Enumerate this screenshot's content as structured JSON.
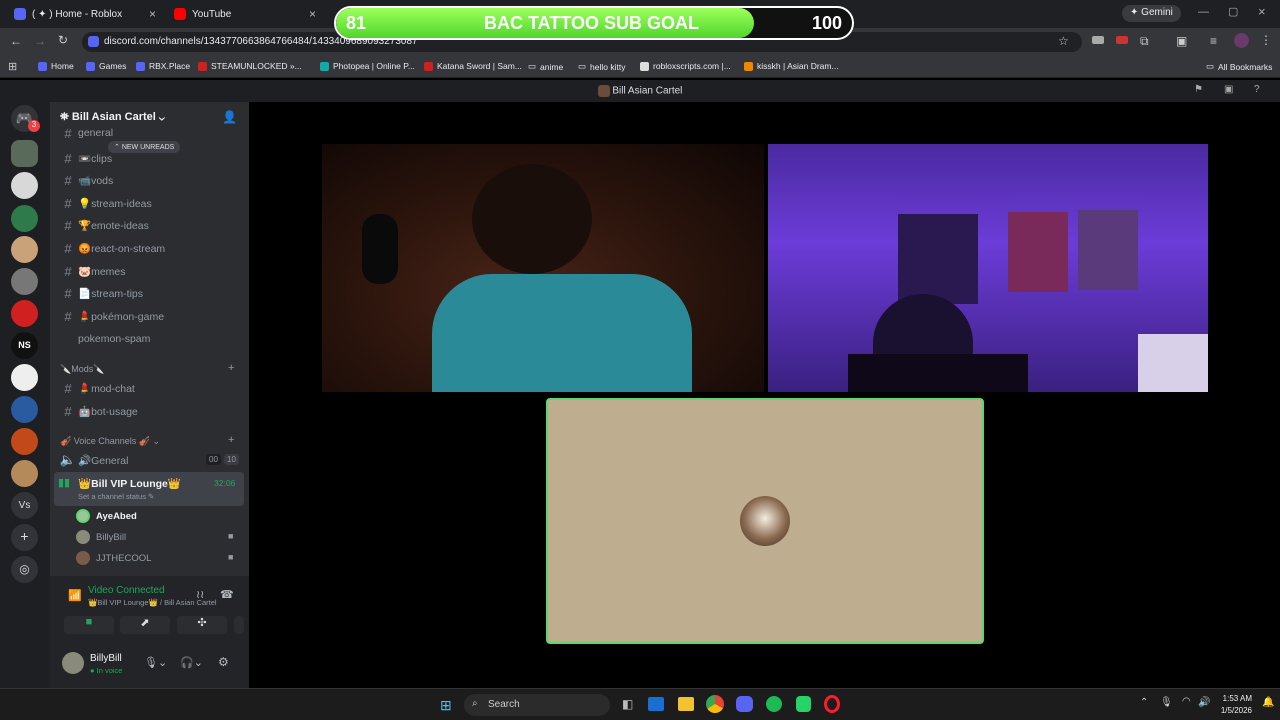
{
  "tabs": [
    {
      "label": "( ✦ ) Home - Roblox"
    },
    {
      "label": "YouTube"
    }
  ],
  "goal": {
    "start": "81",
    "title": "BAC TATTOO SUB GOAL",
    "end": "100",
    "progress": 0.81
  },
  "gemini": "Gemini",
  "url": "discord.com/channels/1343770663864766484/1433409689093273087",
  "bookmarks": [
    "Home",
    "Games",
    "RBX.Place",
    "STEAMUNLOCKED »...",
    "Photopea | Online P...",
    "Katana Sword | Sam...",
    "anime",
    "hello kitty",
    "robloxscripts.com |...",
    "kisskh | Asian Dram..."
  ],
  "all_bookmarks": "All Bookmarks",
  "window_title": "Bill Asian Cartel",
  "server": {
    "name": "Bill Asian Cartel",
    "new_unreads": "NEW UNREADS",
    "mail_badge": "3"
  },
  "channels": [
    "general",
    "📼clips",
    "📹vods",
    "💡stream-ideas",
    "🏆emote-ideas",
    "😡react-on-stream",
    "🐷memes",
    "📄stream-tips",
    "💄pokémon-game",
    "pokemon-spam"
  ],
  "mods_category": "🔪Mods🔪",
  "mod_channels": [
    "💄mod-chat",
    "🤖bot-usage"
  ],
  "voice_category": "🎻 Voice Channels 🎻",
  "voice_channels": [
    {
      "name": "🔊General",
      "count_a": "00",
      "count_b": "10"
    },
    {
      "name": "👑Bill VIP Lounge👑",
      "timer": "32:06",
      "status": "Set a channel status"
    }
  ],
  "voice_users": [
    "AyeAbed",
    "BillyBill",
    "JJTHECOOL"
  ],
  "connection": {
    "status": "Video Connected",
    "location": "👑Bill VIP Lounge👑 / Bill Asian Cartel"
  },
  "user": {
    "name": "BillyBill",
    "status": "In voice"
  },
  "taskbar": {
    "search": "Search",
    "time": "1:53 AM",
    "date": "1/5/2026"
  },
  "icons": [
    "discord-icon",
    "chrome-icon",
    "spotify-icon",
    "search-icon",
    "settings-icon",
    "mic-icon",
    "headphones-icon",
    "camera-icon",
    "screen-share-icon"
  ],
  "colors": {
    "goal_fill": "#5ee83a",
    "connected": "#23a55a",
    "speaking": "#5fd66b"
  }
}
